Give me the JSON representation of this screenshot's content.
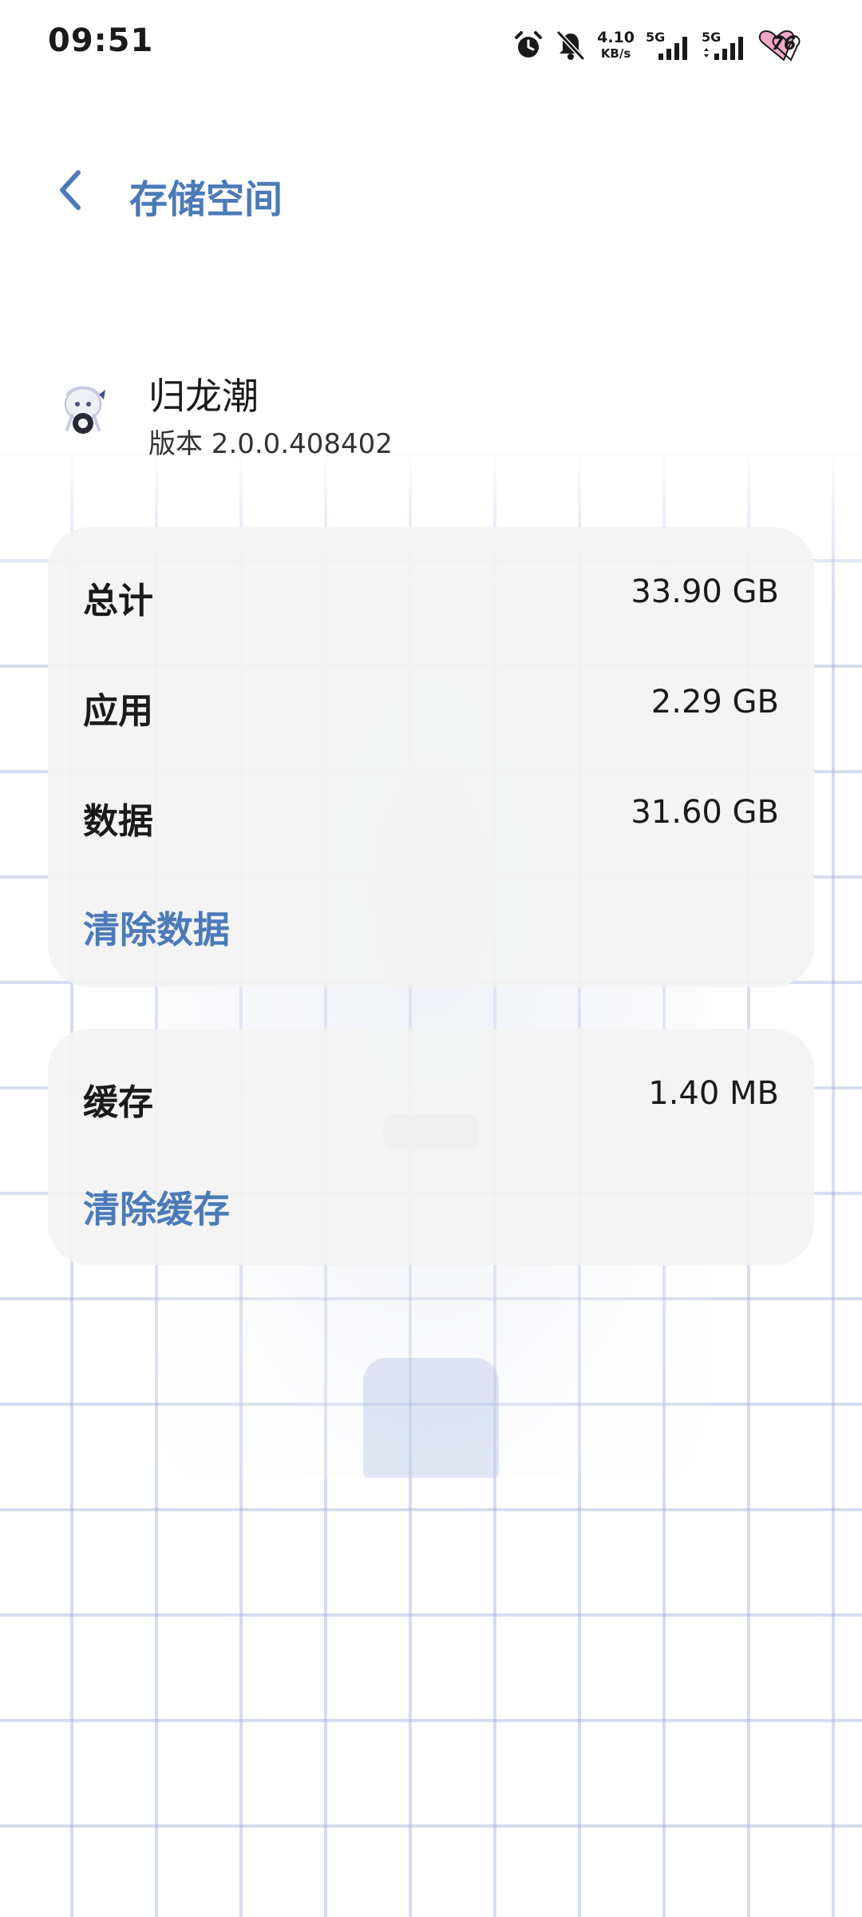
{
  "status_bar": {
    "time": "09:51",
    "net_speed_value": "4.10",
    "net_speed_unit": "KB/s",
    "signal_1_tag": "5G",
    "signal_2_tag": "5G",
    "battery_level": "76",
    "icons": [
      "alarm-icon",
      "bell-off-icon",
      "signal-icon",
      "signal-icon",
      "battery-heart-icon"
    ]
  },
  "header": {
    "back_icon": "chevron-left-icon",
    "title": "存储空间"
  },
  "app": {
    "name": "归龙潮",
    "version": "版本 2.0.0.408402"
  },
  "storage": {
    "rows": [
      {
        "label": "总计",
        "value": "33.90 GB"
      },
      {
        "label": "应用",
        "value": "2.29 GB"
      },
      {
        "label": "数据",
        "value": "31.60 GB"
      }
    ],
    "clear_data_label": "清除数据"
  },
  "cache": {
    "label": "缓存",
    "value": "1.40 MB",
    "clear_cache_label": "清除缓存"
  },
  "colors": {
    "accent": "#4b7ab8",
    "card_background": "#f3f3f3",
    "grid_line": "#96a5d7"
  }
}
